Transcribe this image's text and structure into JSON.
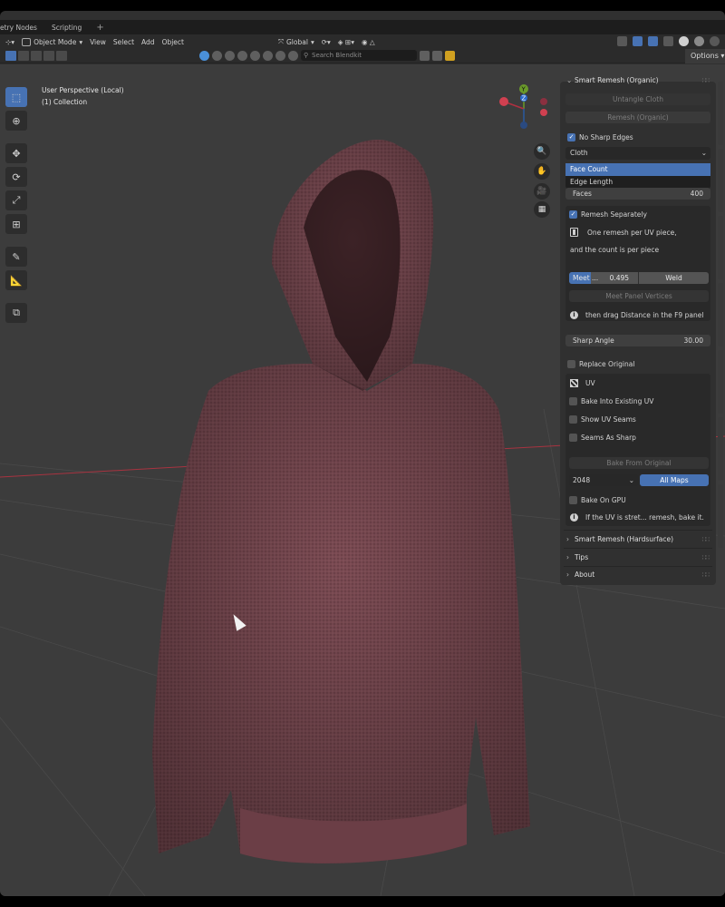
{
  "workspace_tabs": [
    "etry Nodes",
    "Scripting",
    "+"
  ],
  "header": {
    "mode": "Object Mode",
    "menus": [
      "View",
      "Select",
      "Add",
      "Object"
    ],
    "orientation": "Global"
  },
  "toolbar2": {
    "search_placeholder": "Search Blendkit",
    "options_label": "Options"
  },
  "viewport": {
    "line1": "User Perspective (Local)",
    "line2": "(1) Collection"
  },
  "gizmo": {
    "x": "X",
    "y": "Y",
    "z": "Z"
  },
  "panel": {
    "title": "Smart Remesh (Organic)",
    "untangle": "Untangle Cloth",
    "remesh": "Remesh (Organic)",
    "no_sharp": "No Sharp Edges",
    "preset_value": "Cloth",
    "menu_items": [
      "Face Count",
      "Edge Length"
    ],
    "faces_label": "Faces",
    "faces_value": "400",
    "remesh_sep": "Remesh Separately",
    "info1": "One remesh per UV piece,",
    "info2": "and the count is per piece",
    "meet_label": "Meet ...",
    "meet_value": "0.495",
    "meet_fill": 0.32,
    "weld_label": "Weld",
    "meet_vertices": "Meet Panel Vertices",
    "info3": "then drag Distance in the F9 panel",
    "sharp_angle_label": "Sharp Angle",
    "sharp_angle_value": "30.00",
    "replace_original": "Replace Original",
    "uv_label": "UV",
    "bake_existing": "Bake Into Existing UV",
    "show_seams": "Show UV Seams",
    "seams_sharp": "Seams As Sharp",
    "bake_from": "Bake From Original",
    "resolution": "2048",
    "all_maps": "All Maps",
    "bake_gpu": "Bake On GPU",
    "info4": "If the UV is stret... remesh, bake it.",
    "hardsurface": "Smart Remesh (Hardsurface)",
    "tips": "Tips",
    "about": "About"
  },
  "colors": {
    "accent": "#4772b3",
    "hoodie": "#7a4a52",
    "viewport_bg": "#3c3c3c"
  }
}
